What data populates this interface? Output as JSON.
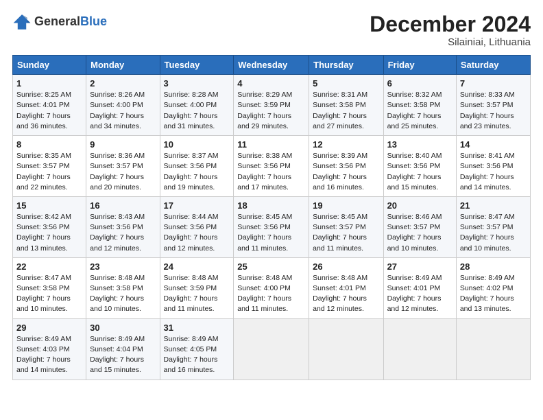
{
  "header": {
    "logo_general": "General",
    "logo_blue": "Blue",
    "month_title": "December 2024",
    "location": "Silainiai, Lithuania"
  },
  "days_of_week": [
    "Sunday",
    "Monday",
    "Tuesday",
    "Wednesday",
    "Thursday",
    "Friday",
    "Saturday"
  ],
  "weeks": [
    [
      {
        "day": "1",
        "sunrise": "Sunrise: 8:25 AM",
        "sunset": "Sunset: 4:01 PM",
        "daylight": "Daylight: 7 hours and 36 minutes."
      },
      {
        "day": "2",
        "sunrise": "Sunrise: 8:26 AM",
        "sunset": "Sunset: 4:00 PM",
        "daylight": "Daylight: 7 hours and 34 minutes."
      },
      {
        "day": "3",
        "sunrise": "Sunrise: 8:28 AM",
        "sunset": "Sunset: 4:00 PM",
        "daylight": "Daylight: 7 hours and 31 minutes."
      },
      {
        "day": "4",
        "sunrise": "Sunrise: 8:29 AM",
        "sunset": "Sunset: 3:59 PM",
        "daylight": "Daylight: 7 hours and 29 minutes."
      },
      {
        "day": "5",
        "sunrise": "Sunrise: 8:31 AM",
        "sunset": "Sunset: 3:58 PM",
        "daylight": "Daylight: 7 hours and 27 minutes."
      },
      {
        "day": "6",
        "sunrise": "Sunrise: 8:32 AM",
        "sunset": "Sunset: 3:58 PM",
        "daylight": "Daylight: 7 hours and 25 minutes."
      },
      {
        "day": "7",
        "sunrise": "Sunrise: 8:33 AM",
        "sunset": "Sunset: 3:57 PM",
        "daylight": "Daylight: 7 hours and 23 minutes."
      }
    ],
    [
      {
        "day": "8",
        "sunrise": "Sunrise: 8:35 AM",
        "sunset": "Sunset: 3:57 PM",
        "daylight": "Daylight: 7 hours and 22 minutes."
      },
      {
        "day": "9",
        "sunrise": "Sunrise: 8:36 AM",
        "sunset": "Sunset: 3:57 PM",
        "daylight": "Daylight: 7 hours and 20 minutes."
      },
      {
        "day": "10",
        "sunrise": "Sunrise: 8:37 AM",
        "sunset": "Sunset: 3:56 PM",
        "daylight": "Daylight: 7 hours and 19 minutes."
      },
      {
        "day": "11",
        "sunrise": "Sunrise: 8:38 AM",
        "sunset": "Sunset: 3:56 PM",
        "daylight": "Daylight: 7 hours and 17 minutes."
      },
      {
        "day": "12",
        "sunrise": "Sunrise: 8:39 AM",
        "sunset": "Sunset: 3:56 PM",
        "daylight": "Daylight: 7 hours and 16 minutes."
      },
      {
        "day": "13",
        "sunrise": "Sunrise: 8:40 AM",
        "sunset": "Sunset: 3:56 PM",
        "daylight": "Daylight: 7 hours and 15 minutes."
      },
      {
        "day": "14",
        "sunrise": "Sunrise: 8:41 AM",
        "sunset": "Sunset: 3:56 PM",
        "daylight": "Daylight: 7 hours and 14 minutes."
      }
    ],
    [
      {
        "day": "15",
        "sunrise": "Sunrise: 8:42 AM",
        "sunset": "Sunset: 3:56 PM",
        "daylight": "Daylight: 7 hours and 13 minutes."
      },
      {
        "day": "16",
        "sunrise": "Sunrise: 8:43 AM",
        "sunset": "Sunset: 3:56 PM",
        "daylight": "Daylight: 7 hours and 12 minutes."
      },
      {
        "day": "17",
        "sunrise": "Sunrise: 8:44 AM",
        "sunset": "Sunset: 3:56 PM",
        "daylight": "Daylight: 7 hours and 12 minutes."
      },
      {
        "day": "18",
        "sunrise": "Sunrise: 8:45 AM",
        "sunset": "Sunset: 3:56 PM",
        "daylight": "Daylight: 7 hours and 11 minutes."
      },
      {
        "day": "19",
        "sunrise": "Sunrise: 8:45 AM",
        "sunset": "Sunset: 3:57 PM",
        "daylight": "Daylight: 7 hours and 11 minutes."
      },
      {
        "day": "20",
        "sunrise": "Sunrise: 8:46 AM",
        "sunset": "Sunset: 3:57 PM",
        "daylight": "Daylight: 7 hours and 10 minutes."
      },
      {
        "day": "21",
        "sunrise": "Sunrise: 8:47 AM",
        "sunset": "Sunset: 3:57 PM",
        "daylight": "Daylight: 7 hours and 10 minutes."
      }
    ],
    [
      {
        "day": "22",
        "sunrise": "Sunrise: 8:47 AM",
        "sunset": "Sunset: 3:58 PM",
        "daylight": "Daylight: 7 hours and 10 minutes."
      },
      {
        "day": "23",
        "sunrise": "Sunrise: 8:48 AM",
        "sunset": "Sunset: 3:58 PM",
        "daylight": "Daylight: 7 hours and 10 minutes."
      },
      {
        "day": "24",
        "sunrise": "Sunrise: 8:48 AM",
        "sunset": "Sunset: 3:59 PM",
        "daylight": "Daylight: 7 hours and 11 minutes."
      },
      {
        "day": "25",
        "sunrise": "Sunrise: 8:48 AM",
        "sunset": "Sunset: 4:00 PM",
        "daylight": "Daylight: 7 hours and 11 minutes."
      },
      {
        "day": "26",
        "sunrise": "Sunrise: 8:48 AM",
        "sunset": "Sunset: 4:01 PM",
        "daylight": "Daylight: 7 hours and 12 minutes."
      },
      {
        "day": "27",
        "sunrise": "Sunrise: 8:49 AM",
        "sunset": "Sunset: 4:01 PM",
        "daylight": "Daylight: 7 hours and 12 minutes."
      },
      {
        "day": "28",
        "sunrise": "Sunrise: 8:49 AM",
        "sunset": "Sunset: 4:02 PM",
        "daylight": "Daylight: 7 hours and 13 minutes."
      }
    ],
    [
      {
        "day": "29",
        "sunrise": "Sunrise: 8:49 AM",
        "sunset": "Sunset: 4:03 PM",
        "daylight": "Daylight: 7 hours and 14 minutes."
      },
      {
        "day": "30",
        "sunrise": "Sunrise: 8:49 AM",
        "sunset": "Sunset: 4:04 PM",
        "daylight": "Daylight: 7 hours and 15 minutes."
      },
      {
        "day": "31",
        "sunrise": "Sunrise: 8:49 AM",
        "sunset": "Sunset: 4:05 PM",
        "daylight": "Daylight: 7 hours and 16 minutes."
      },
      null,
      null,
      null,
      null
    ]
  ]
}
